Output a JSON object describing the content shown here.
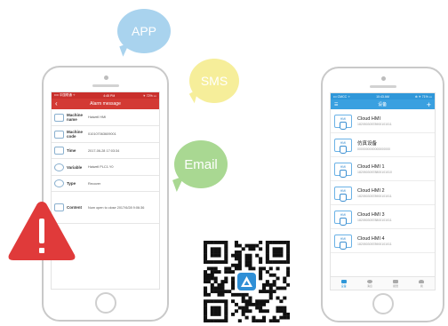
{
  "bubbles": {
    "app": "APP",
    "sms": "SMS",
    "email": "Email"
  },
  "alarm_phone": {
    "status": {
      "carrier": "•••• 中国联通 ✧",
      "time": "4:45 PM",
      "battery": "✈ 72% ▭"
    },
    "nav": {
      "back": "‹",
      "title": "Alarm message"
    },
    "rows": [
      {
        "label": "Machine name",
        "value": "Haiwell HMI"
      },
      {
        "label": "Machine code",
        "value": "010107063609001"
      },
      {
        "label": "Time",
        "value": "2017-06-28 17:03:34"
      },
      {
        "label": "Variable",
        "value": "Haiwell PLC1.Y0"
      },
      {
        "label": "Type",
        "value": "Recover"
      },
      {
        "label": "Content",
        "value": "Num open to close 2017/6/28 9:06:36"
      }
    ]
  },
  "device_phone": {
    "status": {
      "carrier": "••• CMCC ✧",
      "time": "10:43 AM",
      "battery": "⊕ ✈ 71% ▭"
    },
    "nav": {
      "menu": "☰",
      "title": "设备",
      "add": "+"
    },
    "device_icon_text": "HMI",
    "devices": [
      {
        "name": "Cloud HMI",
        "sn": "18205030578900101011"
      },
      {
        "name": "仿真设备",
        "sn": "0000000000000000000"
      },
      {
        "name": "Cloud HMI 1",
        "sn": "18205030578800101010"
      },
      {
        "name": "Cloud HMI 2",
        "sn": "18205030578900101011"
      },
      {
        "name": "Cloud HMI 3",
        "sn": "18205030578800101011"
      },
      {
        "name": "Cloud HMI 4",
        "sn": "18205030578900101011"
      }
    ],
    "tabs": [
      "设备",
      "消息",
      "报警",
      "我"
    ]
  },
  "colors": {
    "alarm_red": "#d33a34",
    "app_blue": "#3aa0e0",
    "bubble_app": "#a9d3ee",
    "bubble_sms": "#f6ee9a",
    "bubble_email": "#a9d892",
    "warning_red": "#e03a3a"
  },
  "icons": {
    "warning": "warning-triangle-icon",
    "qr": "qr-code",
    "qr_center": "cloud-app-logo-icon"
  }
}
